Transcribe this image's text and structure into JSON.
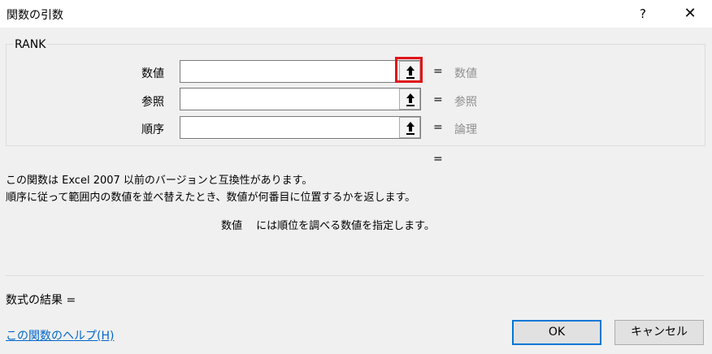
{
  "window": {
    "title": "関数の引数",
    "help_label": "?",
    "close_label": "✕"
  },
  "function": {
    "name": "RANK",
    "args": [
      {
        "label": "数値",
        "value": "",
        "eq": "=",
        "type": "数値"
      },
      {
        "label": "参照",
        "value": "",
        "eq": "=",
        "type": "参照"
      },
      {
        "label": "順序",
        "value": "",
        "eq": "=",
        "type": "論理"
      }
    ],
    "result_eq": "=",
    "description_line1": "この関数は Excel 2007 以前のバージョンと互換性があります。",
    "description_line2": "順序に従って範囲内の数値を並べ替えたとき、数値が何番目に位置するかを返します。",
    "arg_description": "数値　 には順位を調べる数値を指定します。"
  },
  "footer": {
    "formula_result": "数式の結果 =",
    "help_link": "この関数のヘルプ(H)",
    "ok_label": "OK",
    "cancel_label": "キャンセル"
  },
  "colors": {
    "highlight": "#e0131a",
    "link": "#0066cc",
    "accent": "#0078d7"
  }
}
